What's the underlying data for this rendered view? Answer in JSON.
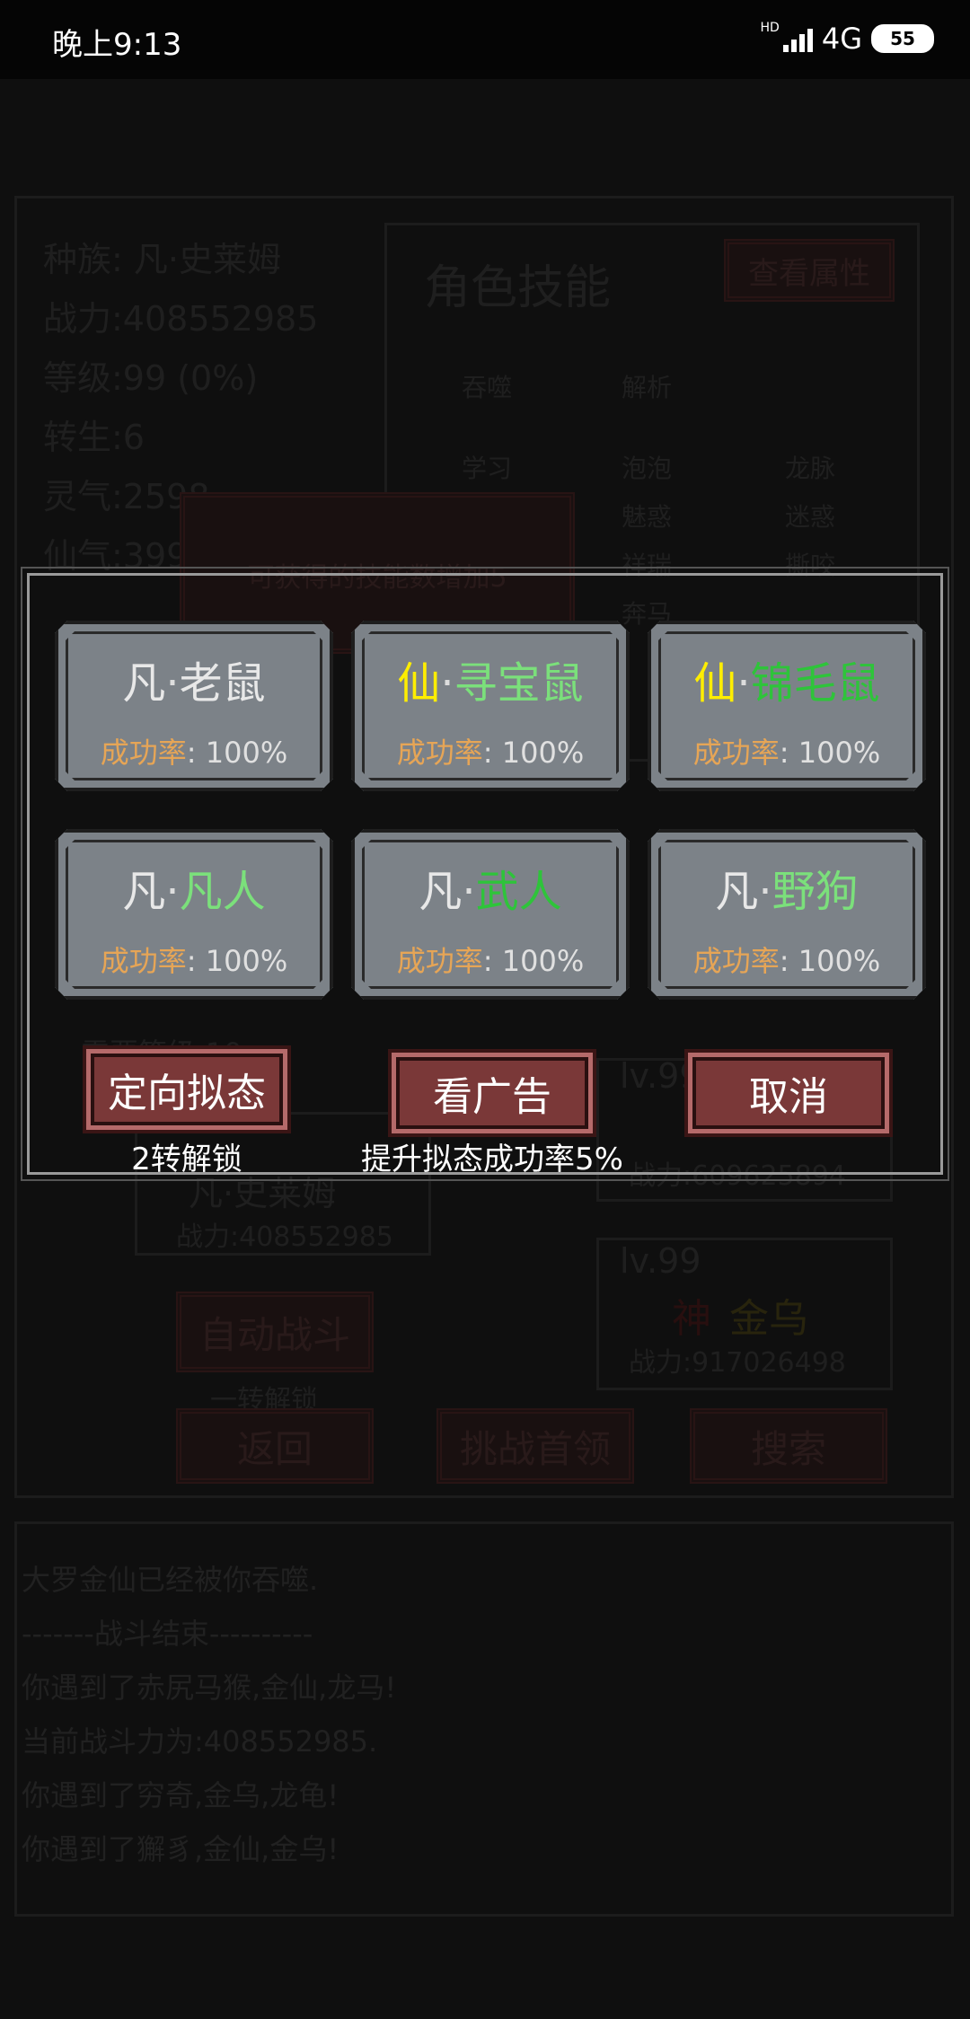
{
  "status": {
    "time": "晚上9:13",
    "hd": "HD",
    "network": "4G",
    "battery": "55"
  },
  "background": {
    "race": "种族:   凡·史莱姆",
    "power": "战力:408552985",
    "level": "等级:99 (0%)",
    "rebirth": "转生:6",
    "lingqi": "灵气:2598",
    "xianqi": "仙气:399",
    "skills_title": "角色技能",
    "view_attr": "查看属性",
    "skill_tabs": [
      "吞噬",
      "解析"
    ],
    "skills": [
      "学习",
      "泡泡",
      "龙脉",
      "魅惑",
      "迷惑",
      "祥瑞",
      "撕咬",
      "奔马"
    ],
    "hint": "可获得的技能数增加5",
    "need_level": "需要等级:10",
    "char_name": "凡·史莱姆",
    "char_power": "战力:408552985",
    "auto_battle": "自动战斗",
    "auto_unlock": "一转解锁",
    "enemy1_level": "lv.99",
    "enemy1_power": "战力:609625894",
    "enemy2_level": "lv.99",
    "enemy2_name_prefix": "神",
    "enemy2_name": "金乌",
    "enemy2_power": "战力:917026498",
    "back": "返回",
    "challenge": "挑战首领",
    "search": "搜索",
    "log": [
      "大罗金仙已经被你吞噬.",
      "-------战斗结束----------",
      "你遇到了赤尻马猴,金仙,龙马!",
      "当前战斗力为:408552985.",
      "你遇到了穷奇,金乌,龙龟!",
      "你遇到了獬豸,金仙,金乌!"
    ]
  },
  "dialog": {
    "cards": [
      {
        "prefix": "凡",
        "name": "老鼠",
        "prefix_color": "#e8e8e8",
        "name_color": "#e8e8e8",
        "rate_label": "成功率",
        "rate": ": 100%"
      },
      {
        "prefix": "仙",
        "name": "寻宝鼠",
        "prefix_color": "#ffee00",
        "name_color": "#7be07b",
        "rate_label": "成功率",
        "rate": ": 100%"
      },
      {
        "prefix": "仙",
        "name": "锦毛鼠",
        "prefix_color": "#ffee00",
        "name_color": "#2ec43a",
        "rate_label": "成功率",
        "rate": ": 100%"
      },
      {
        "prefix": "凡",
        "name": "凡人",
        "prefix_color": "#e8e8e8",
        "name_color": "#7be07b",
        "rate_label": "成功率",
        "rate": ": 100%"
      },
      {
        "prefix": "凡",
        "name": "武人",
        "prefix_color": "#e8e8e8",
        "name_color": "#2ec43a",
        "rate_label": "成功率",
        "rate": ": 100%"
      },
      {
        "prefix": "凡",
        "name": "野狗",
        "prefix_color": "#e8e8e8",
        "name_color": "#7be07b",
        "rate_label": "成功率",
        "rate": ": 100%"
      }
    ],
    "directed_button": "定向拟态",
    "directed_note": "2转解锁",
    "ad_button": "看广告",
    "ad_note": "提升拟态成功率5%",
    "cancel_button": "取消"
  }
}
